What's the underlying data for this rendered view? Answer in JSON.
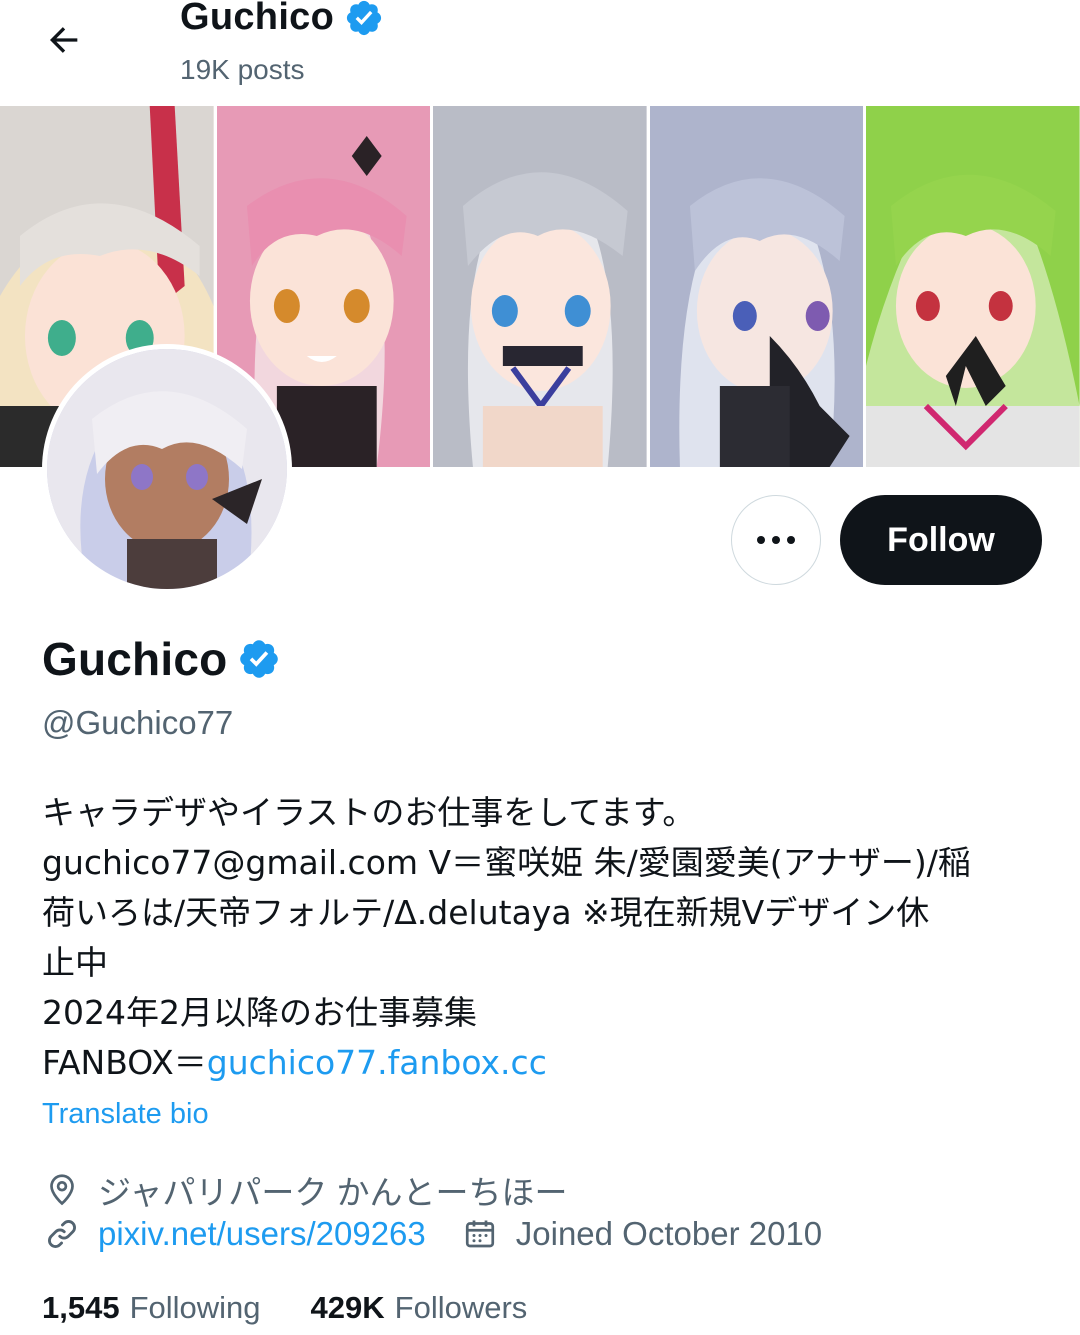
{
  "header": {
    "name": "Guchico",
    "posts": "19K posts"
  },
  "profile": {
    "display_name": "Guchico",
    "handle": "@Guchico77",
    "verified": true,
    "bio_lines": [
      "キャラデザやイラストのお仕事をしてます。",
      "guchico77@gmail.com V＝蜜咲姫 朱/愛園愛美(アナザー)/稲",
      "荷いろは/天帝フォルテ/Δ.delutaya ※現在新規Vデザイン休",
      "止中",
      "2024年2月以降のお仕事募集"
    ],
    "bio_fanbox_prefix": "FANBOX＝",
    "bio_fanbox_link": "guchico77.fanbox.cc",
    "translate_label": "Translate bio",
    "location": "ジャパリパーク かんとーちほー",
    "website": "pixiv.net/users/209263",
    "joined": "Joined October 2010"
  },
  "actions": {
    "follow_label": "Follow"
  },
  "stats": {
    "following_count": "1,545",
    "following_label": "Following",
    "followers_count": "429K",
    "followers_label": "Followers"
  },
  "colors": {
    "accent": "#1d9bf0",
    "text": "#0f1419",
    "secondary": "#536471",
    "follow_bg": "#0f1419"
  },
  "icons": {
    "back": "arrow-left-icon",
    "verified": "verified-badge-icon",
    "more": "more-dots-icon",
    "location": "location-pin-icon",
    "link": "link-icon",
    "calendar": "calendar-icon"
  }
}
